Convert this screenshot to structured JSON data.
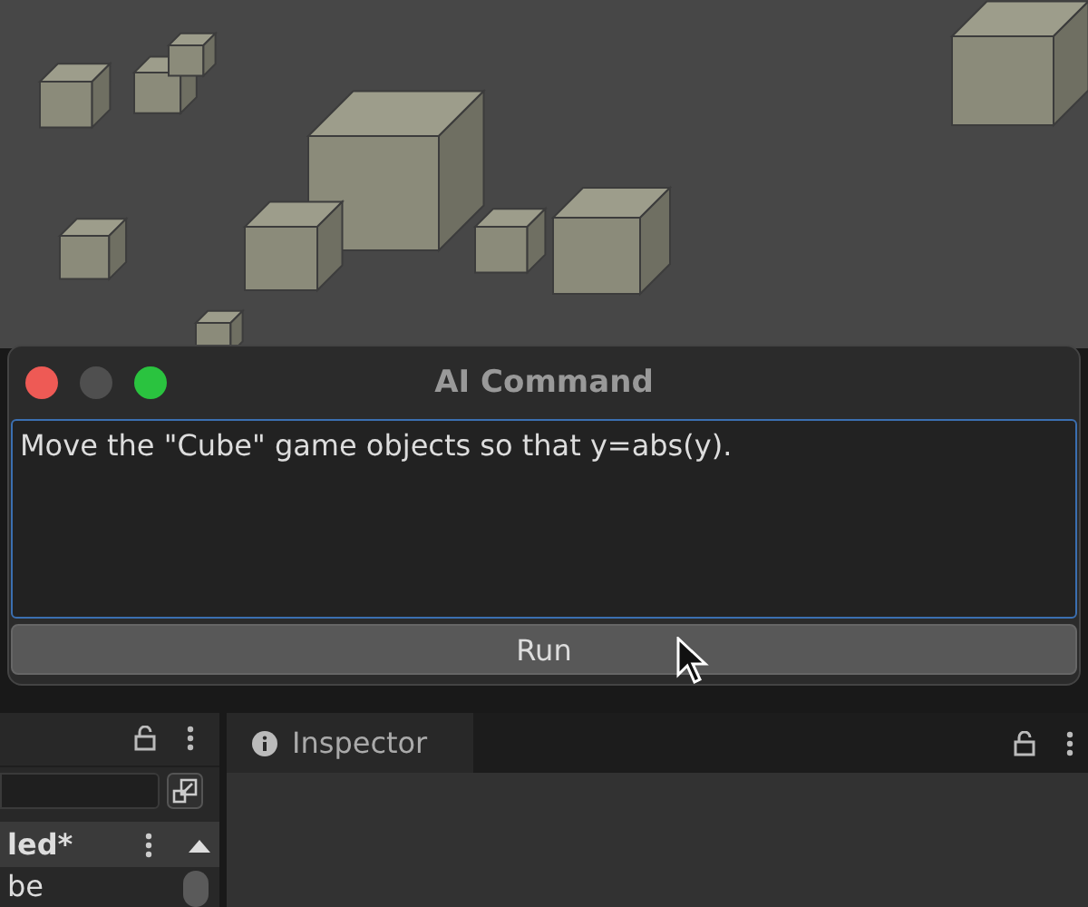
{
  "dialog": {
    "title": "AI Command",
    "command": "Move the \"Cube\" game objects so that y=abs(y).",
    "run_button": "Run"
  },
  "hierarchy": {
    "scene_name": "led*",
    "items": [
      "be"
    ]
  },
  "inspector": {
    "tab": {
      "label": "Inspector",
      "selected": true
    }
  }
}
